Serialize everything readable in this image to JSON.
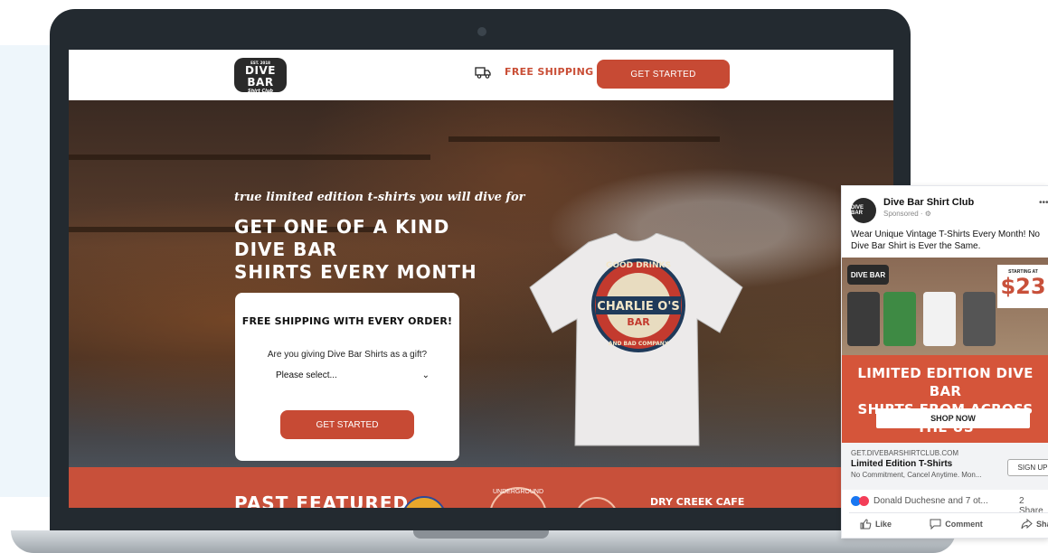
{
  "site": {
    "logo": {
      "line1": "EST. 2018",
      "line2": "DIVE BAR",
      "line3": "Shirt Club"
    },
    "header": {
      "shipping_label": "FREE SHIPPING",
      "cta_label": "GET STARTED"
    },
    "hero": {
      "tagline": "true limited edition t-shirts you will dive for",
      "headline_line1": "GET ONE OF A KIND DIVE BAR",
      "headline_line2": "SHIRTS EVERY MONTH",
      "shirt_text1": "GOOD DRINKS",
      "shirt_text2": "CHARLIE O'S",
      "shirt_text3": "BAR",
      "shirt_text4": "AND BAD COMPANY"
    },
    "form_card": {
      "title": "FREE SHIPPING WITH EVERY ORDER!",
      "question": "Are you giving Dive Bar Shirts as a gift?",
      "select_value": "Please select...",
      "button_label": "GET STARTED"
    },
    "featured": {
      "title": "PAST FEATURED",
      "bar2_text": "UNDERGROUND",
      "bar4_text": "DRY CREEK CAFE"
    }
  },
  "fb_ad": {
    "page_name": "Dive Bar Shirt Club",
    "sponsored": "Sponsored · ⚙",
    "avatar_text": "DIVE BAR",
    "text": "Wear Unique Vintage T-Shirts Every Month! No Dive Bar Shirt is Ever the Same.",
    "image_logo": "DIVE BAR",
    "starting_at": "STARTING AT",
    "price": "$23",
    "headline_line1": "LIMITED EDITION DIVE BAR",
    "headline_line2": "SHIRTS FROM ACROSS THE US",
    "shop_now": "SHOP NOW",
    "url": "GET.DIVEBARSHIRTCLUB.COM",
    "link_title": "Limited Edition T-Shirts",
    "link_sub": "No Commitment, Cancel Anytime. Mon...",
    "signup": "SIGN UP",
    "reactions": "Donald Duchesne and 7 ot...",
    "shares": "2 Share",
    "actions": {
      "like": "Like",
      "comment": "Comment",
      "share": "Share"
    }
  },
  "colors": {
    "accent": "#c74a34",
    "dark": "#232a30",
    "fb_blue": "#1877f2"
  }
}
